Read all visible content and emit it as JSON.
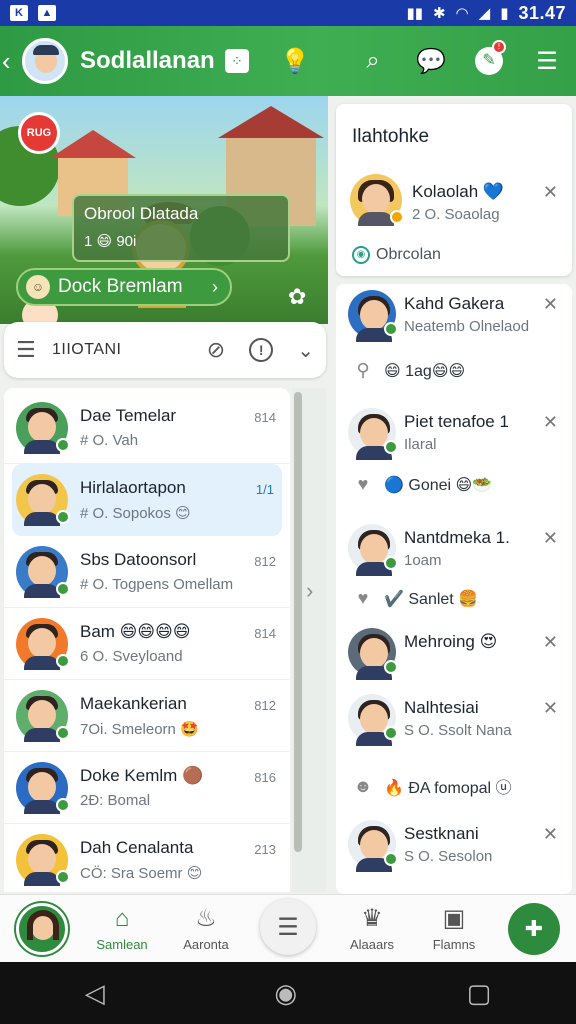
{
  "status_bar": {
    "time": "31.47"
  },
  "header": {
    "title": "Sodlallanan"
  },
  "banner": {
    "live_label": "RUG",
    "info_title": "Obrool Dlatada",
    "info_sub": "1 😄 90i",
    "join_label": "Dock Bremlam"
  },
  "filter": {
    "label": "1IIOTANI"
  },
  "chats": [
    {
      "name": "Dae Temelar",
      "preview": "# O. Vah",
      "time": "814",
      "avatar_bg": "#4aa05a",
      "active": false
    },
    {
      "name": "Hirlalaortapon",
      "preview": "# O. Sopokos 😊",
      "time": "1/1",
      "avatar_bg": "#f2c64a",
      "active": true
    },
    {
      "name": "Sbs Datoonsorl",
      "preview": "# O. Togpens Omellam",
      "time": "812",
      "avatar_bg": "#3a7bc8",
      "active": false
    },
    {
      "name": "Bam 😄😄😄😄",
      "preview": "6 O. Sveyloand",
      "time": "814",
      "avatar_bg": "#f07a2a",
      "active": false
    },
    {
      "name": "Maekankerian",
      "preview": "7Oi. Smeleorn 🤩",
      "time": "812",
      "avatar_bg": "#5fae6b",
      "active": false
    },
    {
      "name": "Doke Kemlm 🟤",
      "preview": "2Ð: Bomal",
      "time": "816",
      "avatar_bg": "#2a6cc4",
      "active": false
    },
    {
      "name": "Dah Cenalanta",
      "preview": "CÖ: Sra Soemr 😊",
      "time": "213",
      "avatar_bg": "#f4c23a",
      "active": false
    }
  ],
  "right_panel": {
    "title": "Ilahtohke",
    "featured": {
      "name": "Kolaolah 💙",
      "sub": "2 O. Soaolag",
      "footer": "Obrcolan"
    }
  },
  "right_items": [
    {
      "name": "Kahd Gakera",
      "sub": "Neatemb Olnelaod",
      "line": "😄 1ag😄😄",
      "line_icon": "pin-icon"
    },
    {
      "name": "Piet tenafoe 1",
      "sub": "Ilaral",
      "line": "🔵 Gonei 😄🥗",
      "line_icon": "heart-icon"
    },
    {
      "name": "Nantdmeka 1.",
      "sub": "1oam",
      "line": "✔️ Sanlet 🍔",
      "line_icon": "heart-icon"
    },
    {
      "name": "Mehroing 😍",
      "sub": "",
      "line": "",
      "line_icon": ""
    },
    {
      "name": "Nalhtesiai",
      "sub": "S O. Ssolt Nana",
      "line": "🔥 ÐA fomopal ⓤ",
      "line_icon": "emoji-icon"
    },
    {
      "name": "Sestknani",
      "sub": "S O. Sesolon",
      "line": "",
      "line_icon": ""
    }
  ],
  "bottom_nav": {
    "tab1": "Samlean",
    "tab2": "Aaronta",
    "tab3": "Alaaars",
    "tab4": "Flamns"
  },
  "colors": {
    "brand_green": "#2e9a44",
    "status_blue": "#1a3aa8"
  }
}
